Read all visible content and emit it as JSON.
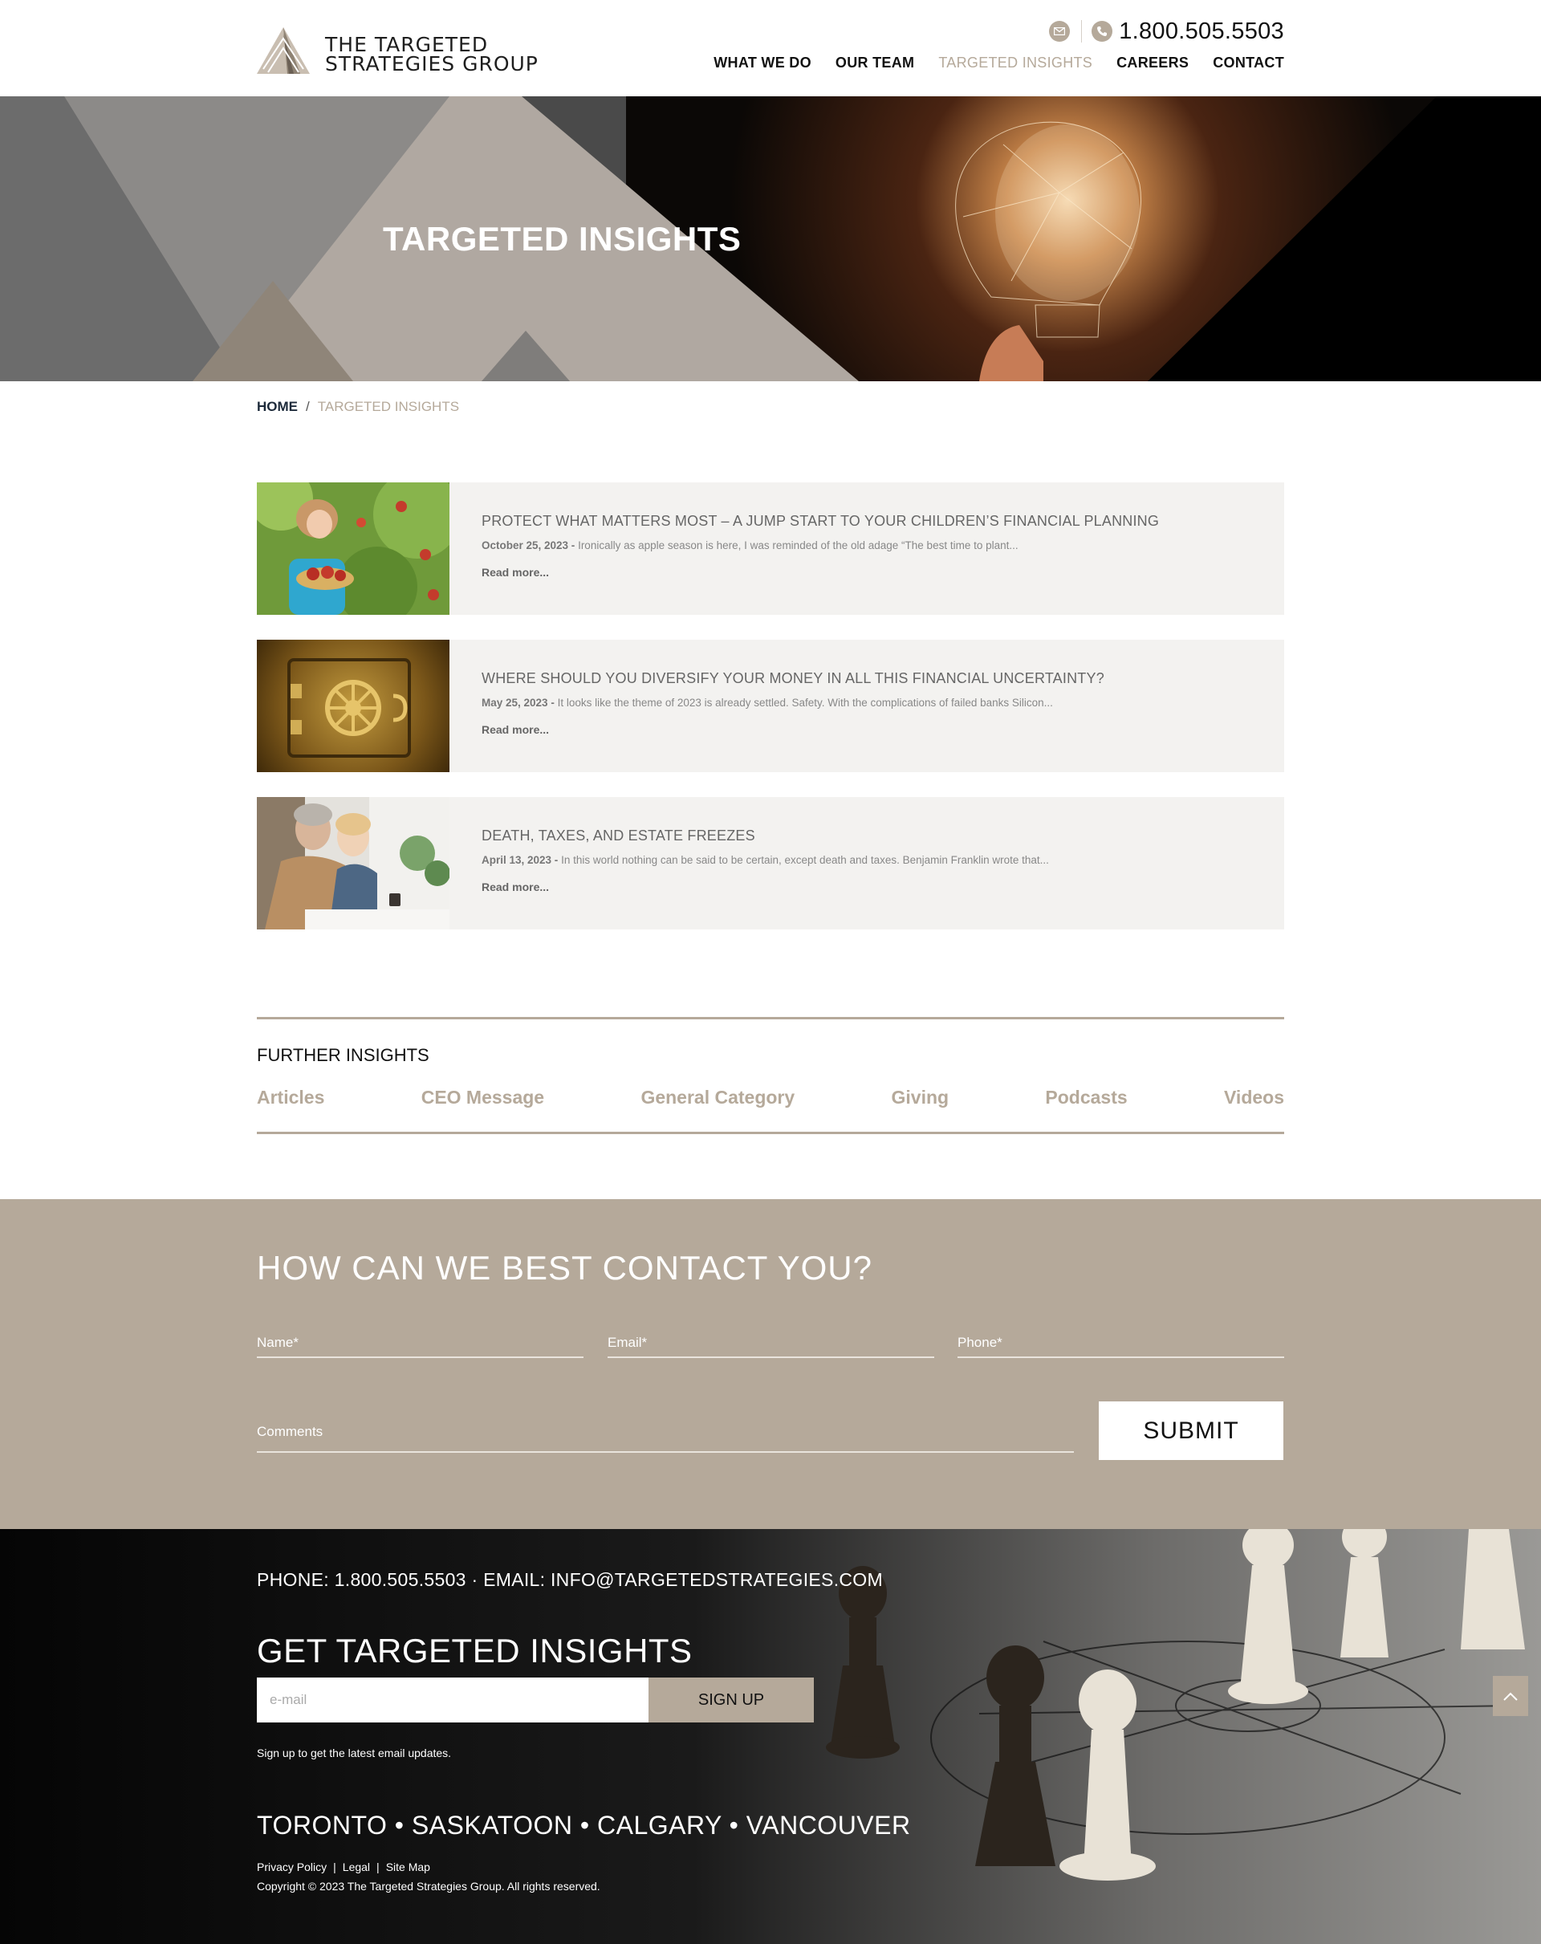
{
  "header": {
    "logo_line1": "THE TARGETED",
    "logo_line2": "STRATEGIES GROUP",
    "phone": "1.800.505.5503",
    "nav": [
      {
        "label": "WHAT WE DO",
        "active": false
      },
      {
        "label": "OUR TEAM",
        "active": false
      },
      {
        "label": "TARGETED INSIGHTS",
        "active": true
      },
      {
        "label": "CAREERS",
        "active": false
      },
      {
        "label": "CONTACT",
        "active": false
      }
    ]
  },
  "hero": {
    "title": "TARGETED INSIGHTS"
  },
  "breadcrumb": {
    "home": "HOME",
    "separator": "/",
    "current": "TARGETED INSIGHTS"
  },
  "articles": [
    {
      "title": "PROTECT WHAT MATTERS MOST – A JUMP START TO YOUR CHILDREN’S FINANCIAL PLANNING",
      "date": "October 25, 2023 -",
      "excerpt": " Ironically as apple season is here, I was reminded of the old adage “The best time to plant...",
      "read_more": "Read more..."
    },
    {
      "title": "WHERE SHOULD YOU DIVERSIFY YOUR MONEY IN ALL THIS FINANCIAL UNCERTAINTY?",
      "date": "May 25, 2023 -",
      "excerpt": " It looks like the theme of 2023 is already settled. Safety. With the complications of failed banks Silicon...",
      "read_more": "Read more..."
    },
    {
      "title": "DEATH, TAXES, AND ESTATE FREEZES",
      "date": "April 13, 2023 -",
      "excerpt": " In this world nothing can be said to be certain, except death and taxes. Benjamin Franklin wrote that...",
      "read_more": "Read more..."
    }
  ],
  "further": {
    "heading": "FURTHER INSIGHTS",
    "categories": [
      "Articles",
      "CEO Message",
      "General Category",
      "Giving",
      "Podcasts",
      "Videos"
    ]
  },
  "contact_form": {
    "heading": "HOW CAN WE BEST CONTACT YOU?",
    "name_placeholder": "Name*",
    "email_placeholder": "Email*",
    "phone_placeholder": "Phone*",
    "comments_placeholder": "Comments",
    "submit_label": "SUBMIT"
  },
  "footer": {
    "contact_line": "PHONE: 1.800.505.5503 · EMAIL: INFO@TARGETEDSTRATEGIES.COM",
    "newsletter_heading": "GET TARGETED INSIGHTS",
    "email_placeholder": "e-mail",
    "signup_label": "SIGN UP",
    "signup_note": "Sign up to get the latest email updates.",
    "cities": "TORONTO • SASKATOON • CALGARY • VANCOUVER",
    "links": [
      "Privacy Policy",
      "Legal",
      "Site Map"
    ],
    "link_separator": "|",
    "copyright": "Copyright © 2023 The Targeted Strategies Group. All rights reserved."
  },
  "colors": {
    "accent": "#b5a99a",
    "text_dark": "#111111",
    "article_bg": "#f3f2f0",
    "footer_bg": "#0e0e0e"
  },
  "icons": {
    "email": "envelope-icon",
    "phone": "phone-icon",
    "back_to_top": "chevron-up-icon"
  }
}
